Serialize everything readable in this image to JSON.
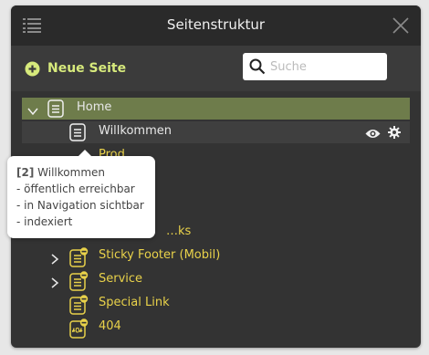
{
  "dialog": {
    "title": "Seitenstruktur",
    "menu_icon": "list-icon",
    "close_icon": "close-icon"
  },
  "toolbar": {
    "new_page_label": "Neue Seite",
    "new_page_icon": "plus-circle-icon",
    "search_placeholder": "Suche",
    "search_value": "",
    "search_icon": "search-icon"
  },
  "colors": {
    "accent_green": "#d7ea7c",
    "home_row_bg": "#6e7c4b",
    "hidden_page_yellow": "#e9d24a",
    "dialog_bg": "#333333"
  },
  "tree": {
    "home": {
      "label": "Home",
      "expanded": true,
      "icon": "page-icon"
    },
    "items": [
      {
        "label": "Willkommen",
        "icon": "page-icon",
        "hover_actions": [
          "eye-icon",
          "gear-icon"
        ]
      },
      {
        "label": "Prod…",
        "icon": "page-icon-hidden"
      },
      {
        "label": "…",
        "icon": "page-icon-hidden"
      },
      {
        "label": "…",
        "icon": "page-icon-hidden"
      },
      {
        "label": "…ks",
        "icon": "page-icon-hidden"
      },
      {
        "label": "Sticky Footer (Mobil)",
        "icon": "page-icon-hidden",
        "expandable": true
      },
      {
        "label": "Service",
        "icon": "page-icon-hidden",
        "expandable": true
      },
      {
        "label": "Special Link",
        "icon": "page-icon-hidden"
      },
      {
        "label": "404",
        "icon": "page-404-icon-hidden"
      }
    ]
  },
  "tooltip": {
    "id": "[2]",
    "title": "Willkommen",
    "lines": [
      "- öffentlich erreichbar",
      "- in Navigation sichtbar",
      "- indexiert"
    ]
  }
}
